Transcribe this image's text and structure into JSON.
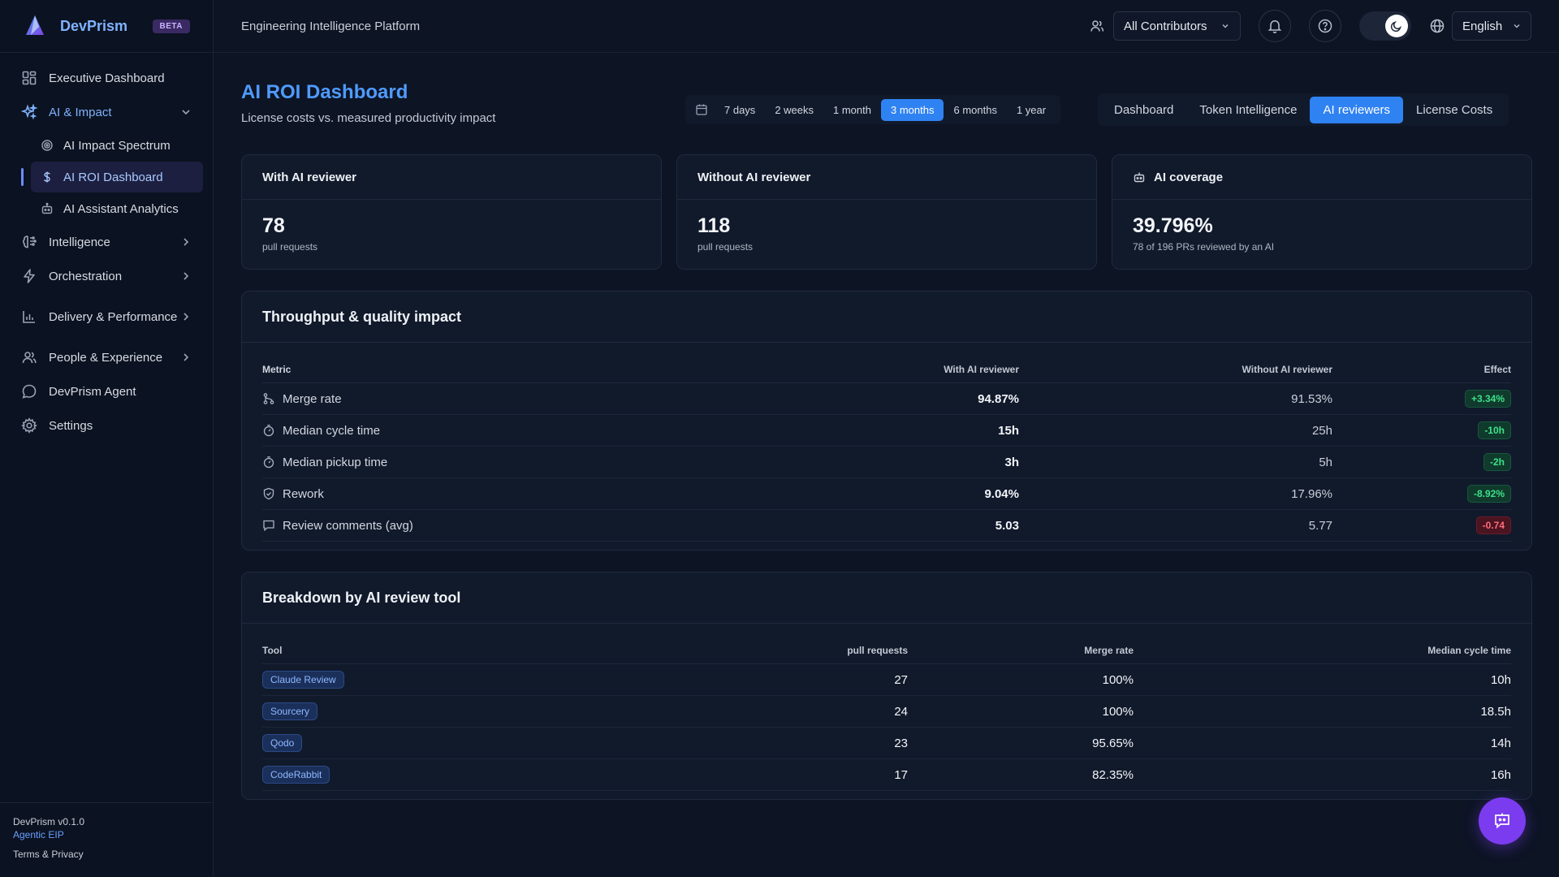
{
  "brand": {
    "name": "DevPrism",
    "badge": "BETA"
  },
  "topbar": {
    "platform": "Engineering Intelligence Platform",
    "contributors": "All Contributors",
    "language": "English"
  },
  "sidebar": {
    "items": [
      {
        "label": "Executive Dashboard",
        "icon": "dashboard-icon"
      },
      {
        "label": "AI & Impact",
        "icon": "sparkles-icon"
      },
      {
        "label": "Intelligence",
        "icon": "brain-icon"
      },
      {
        "label": "Orchestration",
        "icon": "bolt-icon"
      },
      {
        "label": "Delivery & Performance",
        "icon": "bar-chart-icon"
      },
      {
        "label": "People & Experience",
        "icon": "users-icon"
      },
      {
        "label": "DevPrism Agent",
        "icon": "chat-icon"
      },
      {
        "label": "Settings",
        "icon": "gear-icon"
      }
    ],
    "sub_items": [
      {
        "label": "AI Impact Spectrum",
        "icon": "target-icon"
      },
      {
        "label": "AI ROI Dashboard",
        "icon": "dollar-icon"
      },
      {
        "label": "AI Assistant Analytics",
        "icon": "robot-icon"
      }
    ],
    "footer": {
      "version": "DevPrism v0.1.0",
      "tagline": "Agentic EIP",
      "terms": "Terms & Privacy"
    }
  },
  "page": {
    "title": "AI ROI Dashboard",
    "subtitle": "License costs vs. measured productivity impact"
  },
  "ranges": [
    "7 days",
    "2 weeks",
    "1 month",
    "3 months",
    "6 months",
    "1 year"
  ],
  "selected_range": "3 months",
  "view_tabs": [
    "Dashboard",
    "Token Intelligence",
    "AI reviewers",
    "License Costs"
  ],
  "selected_tab": "AI reviewers",
  "cards": [
    {
      "title": "With AI reviewer",
      "value": "78",
      "caption": "pull requests"
    },
    {
      "title": "Without AI reviewer",
      "value": "118",
      "caption": "pull requests"
    },
    {
      "title": "AI coverage",
      "value": "39.796%",
      "caption": "78 of 196 PRs reviewed by an AI"
    }
  ],
  "throughput": {
    "title": "Throughput & quality impact",
    "headers": [
      "Metric",
      "With AI reviewer",
      "Without AI reviewer",
      "Effect"
    ],
    "rows": [
      {
        "metric": "Merge rate",
        "icon": "merge-icon",
        "with": "94.87%",
        "without": "91.53%",
        "effect": "+3.34%",
        "tone": "pos"
      },
      {
        "metric": "Median cycle time",
        "icon": "timer-icon",
        "with": "15h",
        "without": "25h",
        "effect": "-10h",
        "tone": "pos"
      },
      {
        "metric": "Median pickup time",
        "icon": "timer-icon",
        "with": "3h",
        "without": "5h",
        "effect": "-2h",
        "tone": "pos"
      },
      {
        "metric": "Rework",
        "icon": "shield-icon",
        "with": "9.04%",
        "without": "17.96%",
        "effect": "-8.92%",
        "tone": "pos"
      },
      {
        "metric": "Review comments (avg)",
        "icon": "comment-icon",
        "with": "5.03",
        "without": "5.77",
        "effect": "-0.74",
        "tone": "neg"
      }
    ]
  },
  "breakdown": {
    "title": "Breakdown by AI review tool",
    "headers": [
      "Tool",
      "pull requests",
      "Merge rate",
      "Median cycle time"
    ],
    "rows": [
      {
        "tool": "Claude Review",
        "prs": "27",
        "merge_rate": "100%",
        "cycle": "10h"
      },
      {
        "tool": "Sourcery",
        "prs": "24",
        "merge_rate": "100%",
        "cycle": "18.5h"
      },
      {
        "tool": "Qodo",
        "prs": "23",
        "merge_rate": "95.65%",
        "cycle": "14h"
      },
      {
        "tool": "CodeRabbit",
        "prs": "17",
        "merge_rate": "82.35%",
        "cycle": "16h"
      }
    ]
  },
  "colors": {
    "accent": "#2f82f2",
    "title": "#4f9bff",
    "positive": "#3ee08a",
    "negative": "#ff6b7a",
    "fab": "#7b3cf0"
  }
}
